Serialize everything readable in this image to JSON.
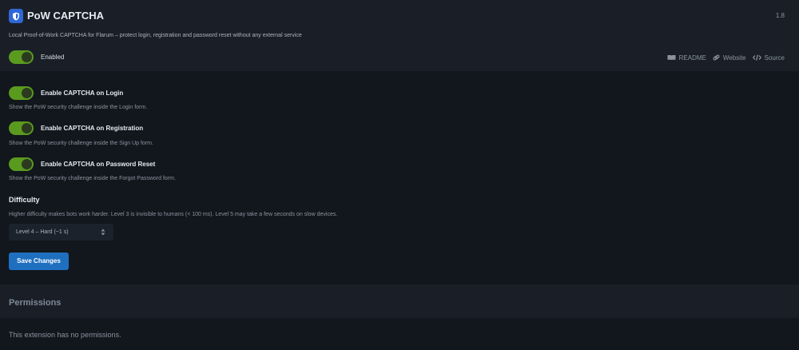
{
  "extension": {
    "title": "PoW CAPTCHA",
    "version": "1.8",
    "description": "Local Proof-of-Work CAPTCHA for Flarum – protect login, registration and password reset without any external service",
    "enabled_label": "Enabled",
    "enabled": true,
    "icon": "shield-icon"
  },
  "links": [
    {
      "label": "README",
      "icon": "book-icon"
    },
    {
      "label": "Website",
      "icon": "link-icon"
    },
    {
      "label": "Source",
      "icon": "code-icon"
    }
  ],
  "settings": [
    {
      "label": "Enable CAPTCHA on Login",
      "help": "Show the PoW security challenge inside the Login form.",
      "enabled": true
    },
    {
      "label": "Enable CAPTCHA on Registration",
      "help": "Show the PoW security challenge inside the Sign Up form.",
      "enabled": true
    },
    {
      "label": "Enable CAPTCHA on Password Reset",
      "help": "Show the PoW security challenge inside the Forgot Password form.",
      "enabled": true
    }
  ],
  "difficulty": {
    "title": "Difficulty",
    "help": "Higher difficulty makes bots work harder. Level 3 is invisible to humans (< 100 ms). Level 5 may take a few seconds on slow devices.",
    "selected": "Level 4 – Hard (~1 s)"
  },
  "save_label": "Save Changes",
  "permissions": {
    "title": "Permissions",
    "message": "This extension has no permissions."
  },
  "colors": {
    "accent": "#1f6fc0",
    "toggle_on": "#5a9a1f",
    "background": "#12161d",
    "panel": "#1a1f27"
  }
}
